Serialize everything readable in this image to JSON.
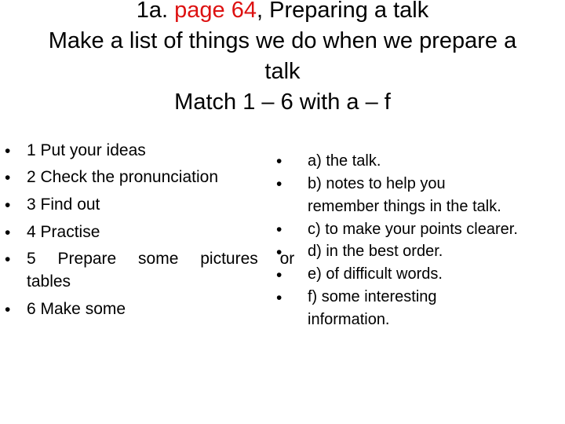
{
  "title": {
    "line1_prefix": "1a. ",
    "line1_highlight": "page 64",
    "line1_suffix": ", Preparing a talk",
    "line2": "Make a list of things we do when we prepare a",
    "line3": "talk",
    "line4": "Match 1 – 6 with a – f"
  },
  "colors": {
    "highlight": "#dd1111",
    "text": "#000000",
    "background": "#ffffff"
  },
  "left_list": {
    "items": [
      "1 Put your ideas",
      "2 Check the pronunciation",
      "3 Find out",
      "4 Practise",
      "5 Prepare some pictures or",
      "tables",
      "6 Make some"
    ]
  },
  "right_list": {
    "items": [
      "a) the talk.",
      "b) notes to help you",
      "remember things in the talk.",
      "c) to make your points clearer.",
      "d) in the best order.",
      "e) of difficult words.",
      "f) some interesting",
      "information."
    ]
  },
  "bullet": "•"
}
